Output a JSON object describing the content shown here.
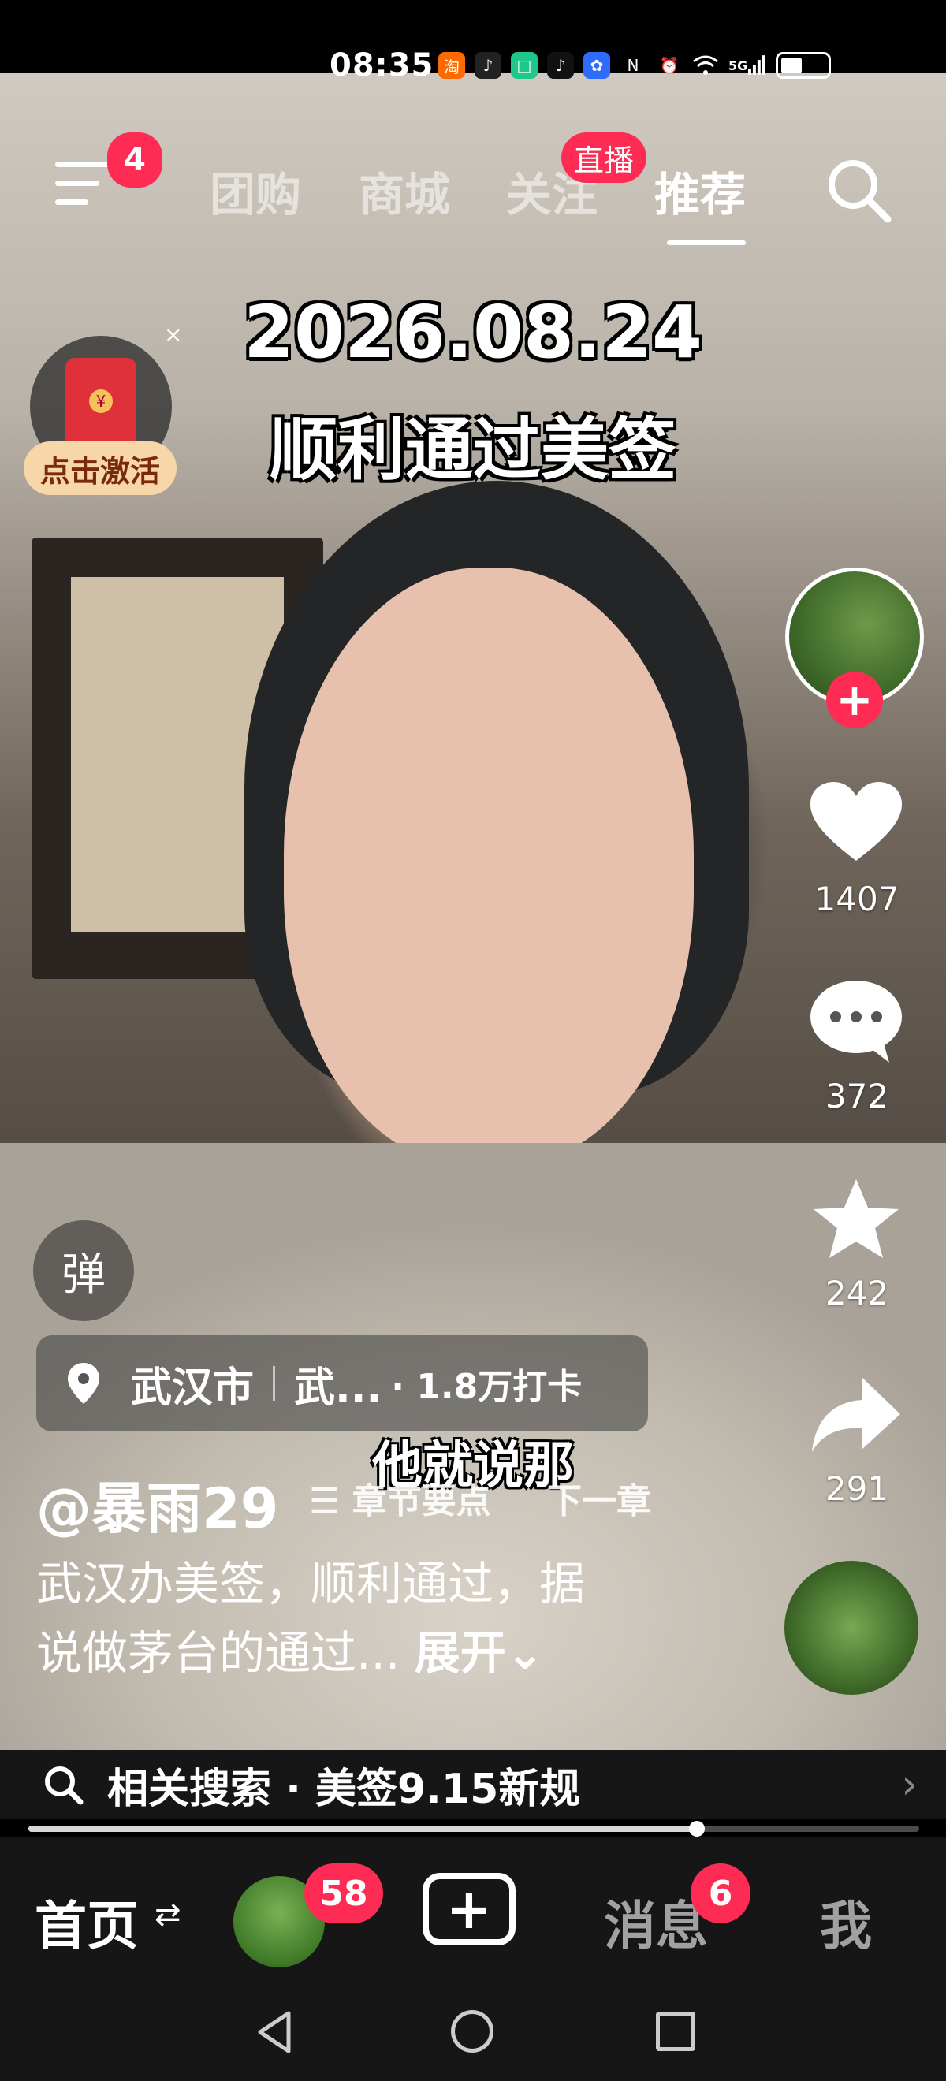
{
  "status_bar": {
    "time": "08:35",
    "icons": [
      "taobao-icon",
      "douyin-icon",
      "app-icon",
      "tiktok-icon",
      "baidu-icon",
      "nfc-icon",
      "alarm-icon",
      "wifi-icon",
      "signal-5g-icon",
      "battery-icon"
    ],
    "network": "5G"
  },
  "top_nav": {
    "menu_badge": "4",
    "tabs": [
      {
        "label": "团购",
        "active": false
      },
      {
        "label": "商城",
        "active": false
      },
      {
        "label": "关注",
        "active": false
      },
      {
        "label": "推荐",
        "active": true
      }
    ],
    "live_badge": "直播"
  },
  "promo": {
    "label": "点击激活",
    "close": "×"
  },
  "video": {
    "overlay_date": "2026.08.24",
    "overlay_title": "顺利通过美签",
    "subtitle": "他就说那"
  },
  "right_rail": {
    "like_count": "1407",
    "comment_count": "372",
    "favorite_count": "242",
    "share_count": "291"
  },
  "danmu_label": "弹",
  "location": {
    "city": "武汉市",
    "place": "武...",
    "checkins": "· 1.8万打卡"
  },
  "post": {
    "username": "@暴雨29",
    "chapter_label": "章节要点",
    "next_chapter": "下一章",
    "caption_line1": "武汉办美签，顺利通过，据",
    "caption_line2": "说做茅台的通过...",
    "expand_label": "展开"
  },
  "related_search": {
    "text": "相关搜索 · 美签9.15新规"
  },
  "playback": {
    "progress": 0.75
  },
  "bottom_nav": {
    "home": "首页",
    "friends_badge": "58",
    "messages": "消息",
    "messages_badge": "6",
    "me": "我"
  },
  "colors": {
    "accent": "#fe2c55",
    "nav_bg": "#161616"
  }
}
